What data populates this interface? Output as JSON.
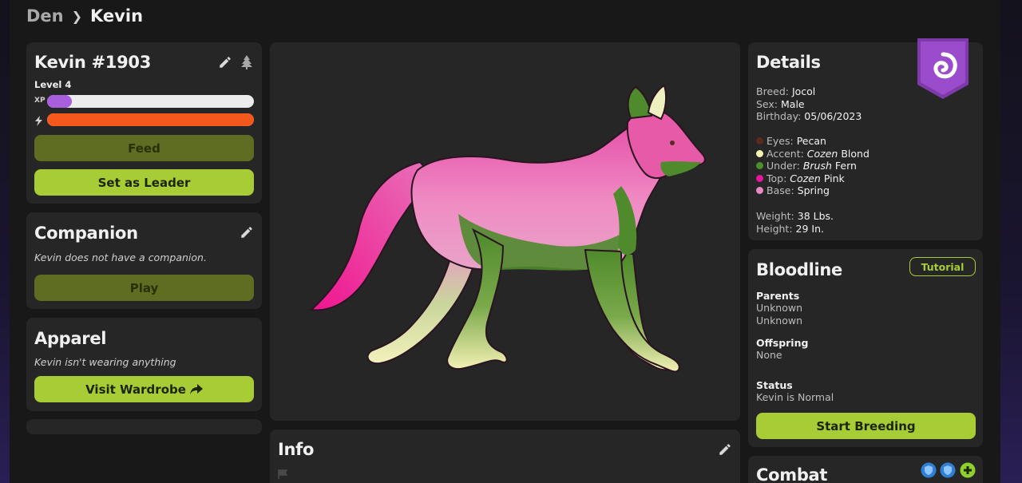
{
  "breadcrumb": {
    "root": "Den",
    "current": "Kevin"
  },
  "profile": {
    "name": "Kevin #1903",
    "level": "Level 4",
    "xp_label": "XP",
    "xp_fraction": 0.12,
    "energy_fraction": 1.0,
    "feed_label": "Feed",
    "leader_label": "Set as Leader"
  },
  "companion": {
    "title": "Companion",
    "text": "Kevin does not have a companion.",
    "play_label": "Play"
  },
  "apparel": {
    "title": "Apparel",
    "text": "Kevin isn't wearing anything",
    "wardrobe_label": "Visit Wardrobe"
  },
  "info": {
    "title": "Info"
  },
  "details": {
    "title": "Details",
    "breed_label": "Breed:",
    "breed": "Jocol",
    "sex_label": "Sex:",
    "sex": "Male",
    "birthday_label": "Birthday:",
    "birthday": "05/06/2023",
    "genes": [
      {
        "label": "Eyes:",
        "mod": "",
        "value": "Pecan",
        "color": "#5a2a1f"
      },
      {
        "label": "Accent:",
        "mod": "Cozen",
        "value": "Blond",
        "color": "#f5f3b0"
      },
      {
        "label": "Under:",
        "mod": "Brush",
        "value": "Fern",
        "color": "#4e8f2c"
      },
      {
        "label": "Top:",
        "mod": "Cozen",
        "value": "Pink",
        "color": "#e8169a"
      },
      {
        "label": "Base:",
        "mod": "",
        "value": "Spring",
        "color": "#e58ac2"
      }
    ],
    "weight_label": "Weight:",
    "weight": "38 Lbs.",
    "height_label": "Height:",
    "height": "29 In."
  },
  "bloodline": {
    "title": "Bloodline",
    "tutorial_label": "Tutorial",
    "parents_label": "Parents",
    "parent_1": "Unknown",
    "parent_2": "Unknown",
    "offspring_label": "Offspring",
    "offspring": "None",
    "status_label": "Status",
    "status": "Kevin is Normal",
    "breed_button": "Start Breeding"
  },
  "combat": {
    "title": "Combat"
  },
  "colors": {
    "xp": "#a95ede",
    "energy": "#f4581c",
    "lime": "#a7cc35",
    "olive": "#5e6d22",
    "badge": "#8a3fb8"
  }
}
